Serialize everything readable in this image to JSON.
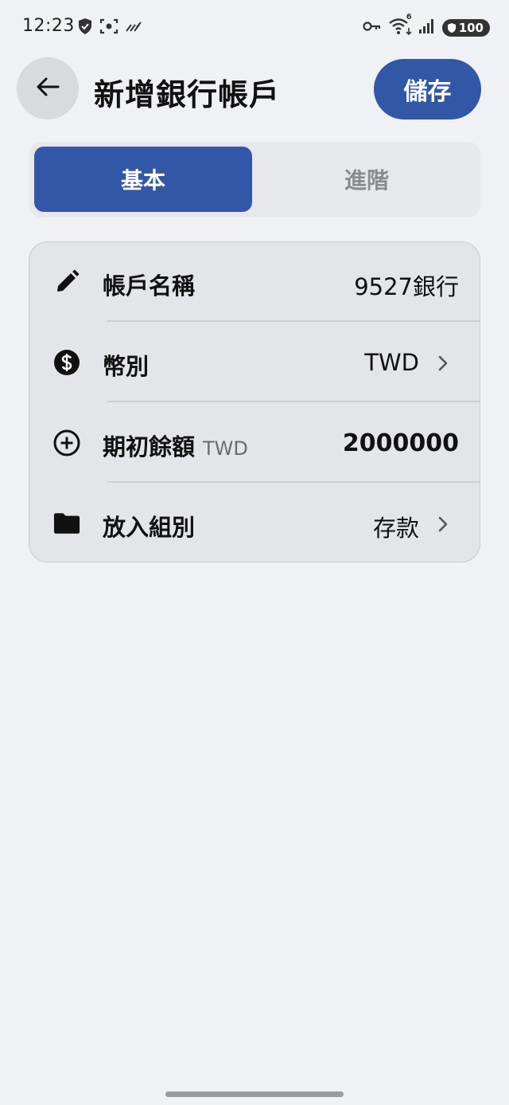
{
  "status_bar": {
    "time": "12:23",
    "battery": "100",
    "network_generation": "6",
    "icons": [
      "shield-icon",
      "screenshot-icon",
      "signal-lines-icon",
      "key-icon",
      "wifi-icon",
      "cell-signal-icon",
      "battery-icon"
    ]
  },
  "header": {
    "title": "新增銀行帳戶",
    "save_label": "儲存",
    "back_icon": "arrow-left-icon"
  },
  "tabs": [
    {
      "label": "基本",
      "active": true
    },
    {
      "label": "進階",
      "active": false
    }
  ],
  "form": {
    "rows": [
      {
        "icon": "pencil-icon",
        "label": "帳戶名稱",
        "value": "9527銀行"
      },
      {
        "icon": "dollar-circle-icon",
        "label": "幣別",
        "value": "TWD"
      },
      {
        "icon": "plus-circle-icon",
        "label": "期初餘額",
        "sublabel": "TWD",
        "value": "2000000"
      },
      {
        "icon": "folder-icon",
        "label": "放入組別",
        "value": "存款"
      }
    ]
  },
  "colors": {
    "accent": "#3357a7",
    "background": "#f0f1f4",
    "card": "#e4e5e8"
  }
}
